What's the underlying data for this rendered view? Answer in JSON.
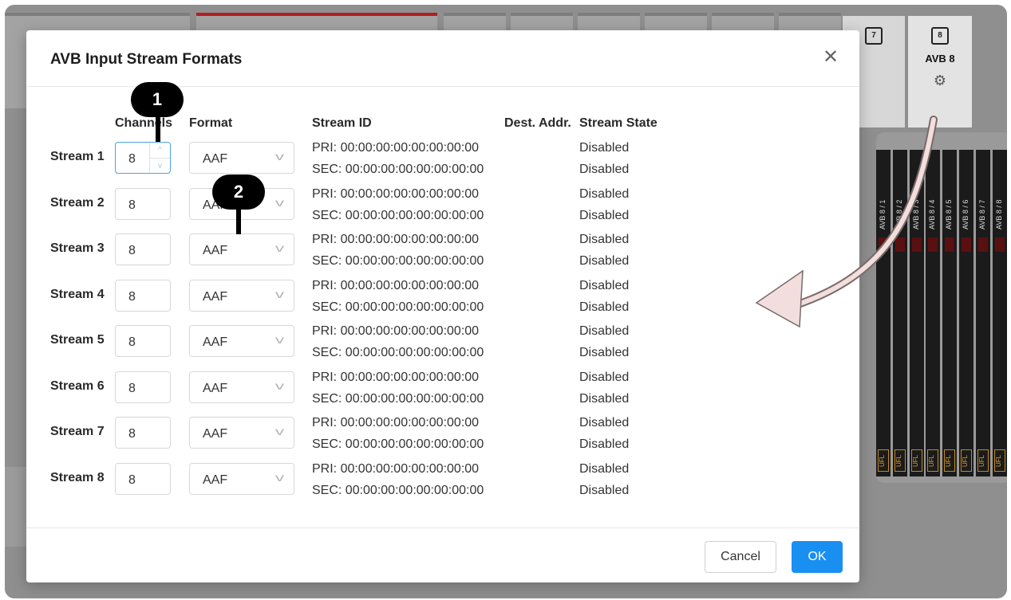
{
  "background": {
    "avb_tab": {
      "label": "AVB 8",
      "icon": "network-port-8-icon"
    },
    "prev_tab_icon": "network-port-7-icon",
    "channel_strips": [
      {
        "label": "AVB 8 / 1",
        "ufl": "UFL"
      },
      {
        "label": "AVB 8 / 2",
        "ufl": "UFL"
      },
      {
        "label": "AVB 8 / 3",
        "ufl": "UFL"
      },
      {
        "label": "AVB 8 / 4",
        "ufl": "UFL"
      },
      {
        "label": "AVB 8 / 5",
        "ufl": "UFL"
      },
      {
        "label": "AVB 8 / 6",
        "ufl": "UFL"
      },
      {
        "label": "AVB 8 / 7",
        "ufl": "UFL"
      },
      {
        "label": "AVB 8 / 8",
        "ufl": "UFL"
      }
    ]
  },
  "dialog": {
    "title": "AVB Input Stream Formats",
    "close_icon": "close-icon",
    "headers": {
      "channels": "Channels",
      "format": "Format",
      "stream_id": "Stream ID",
      "dest_addr": "Dest. Addr.",
      "stream_state": "Stream State"
    },
    "rows": [
      {
        "label": "Stream 1",
        "channels": "8",
        "format": "AAF",
        "pri": "PRI: 00:00:00:00:00:00:00:00",
        "sec": "SEC: 00:00:00:00:00:00:00:00",
        "state_pri": "Disabled",
        "state_sec": "Disabled"
      },
      {
        "label": "Stream 2",
        "channels": "8",
        "format": "AAF",
        "pri": "PRI: 00:00:00:00:00:00:00:00",
        "sec": "SEC: 00:00:00:00:00:00:00:00",
        "state_pri": "Disabled",
        "state_sec": "Disabled"
      },
      {
        "label": "Stream 3",
        "channels": "8",
        "format": "AAF",
        "pri": "PRI: 00:00:00:00:00:00:00:00",
        "sec": "SEC: 00:00:00:00:00:00:00:00",
        "state_pri": "Disabled",
        "state_sec": "Disabled"
      },
      {
        "label": "Stream 4",
        "channels": "8",
        "format": "AAF",
        "pri": "PRI: 00:00:00:00:00:00:00:00",
        "sec": "SEC: 00:00:00:00:00:00:00:00",
        "state_pri": "Disabled",
        "state_sec": "Disabled"
      },
      {
        "label": "Stream 5",
        "channels": "8",
        "format": "AAF",
        "pri": "PRI: 00:00:00:00:00:00:00:00",
        "sec": "SEC: 00:00:00:00:00:00:00:00",
        "state_pri": "Disabled",
        "state_sec": "Disabled"
      },
      {
        "label": "Stream 6",
        "channels": "8",
        "format": "AAF",
        "pri": "PRI: 00:00:00:00:00:00:00:00",
        "sec": "SEC: 00:00:00:00:00:00:00:00",
        "state_pri": "Disabled",
        "state_sec": "Disabled"
      },
      {
        "label": "Stream 7",
        "channels": "8",
        "format": "AAF",
        "pri": "PRI: 00:00:00:00:00:00:00:00",
        "sec": "SEC: 00:00:00:00:00:00:00:00",
        "state_pri": "Disabled",
        "state_sec": "Disabled"
      },
      {
        "label": "Stream 8",
        "channels": "8",
        "format": "AAF",
        "pri": "PRI: 00:00:00:00:00:00:00:00",
        "sec": "SEC: 00:00:00:00:00:00:00:00",
        "state_pri": "Disabled",
        "state_sec": "Disabled"
      }
    ],
    "cancel_label": "Cancel",
    "ok_label": "OK"
  },
  "annotations": {
    "callout_1": "1",
    "callout_2": "2"
  },
  "colors": {
    "ok_button": "#1a8ff2",
    "focus_border": "#4ba3e6",
    "active_tab": "#b21f1f",
    "arrow": "#f3dede"
  }
}
